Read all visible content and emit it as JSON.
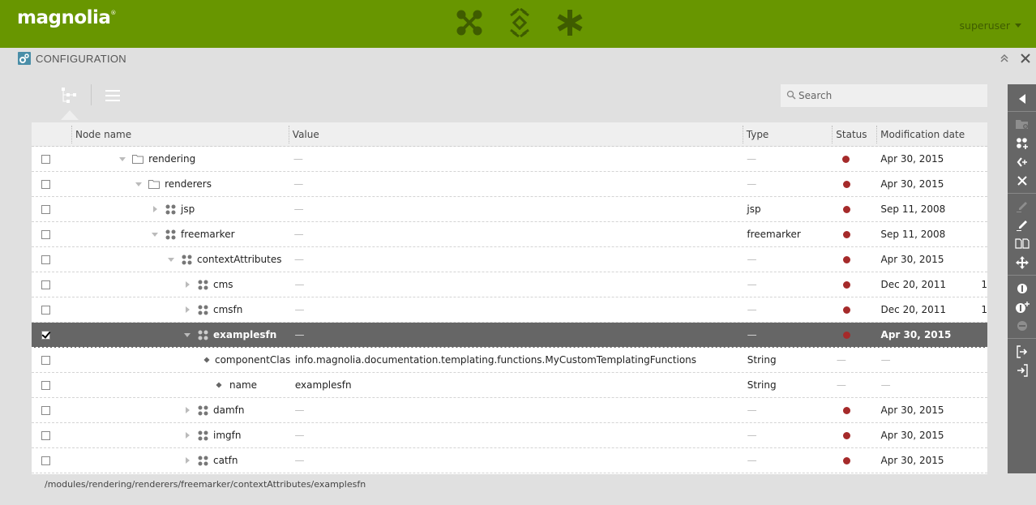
{
  "topbar": {
    "logo": "magnolia",
    "logo_mark": "®",
    "apps": [
      {
        "icon": "applauncher-icon",
        "label": "App launcher"
      },
      {
        "icon": "pulse-icon",
        "label": "Pulse"
      },
      {
        "icon": "favorites-icon",
        "label": "Favorites"
      }
    ],
    "user": "superuser"
  },
  "app": {
    "title": "CONFIGURATION",
    "icon": "configuration-gears-icon",
    "controls": [
      "collapse-icon",
      "close-icon"
    ]
  },
  "views": [
    {
      "icon": "tree-view-icon",
      "active": true
    },
    {
      "icon": "list-view-icon",
      "active": false
    }
  ],
  "search": {
    "placeholder": "Search",
    "value": ""
  },
  "grid": {
    "columns": [
      "Node name",
      "Value",
      "Type",
      "Status",
      "Modification date"
    ],
    "rows": [
      {
        "level": 0,
        "toggle": "expanded",
        "icon": "folder",
        "name": "rendering",
        "value": "—",
        "type": "—",
        "status": "published-modified",
        "date": "Apr 30, 2015",
        "checked": false,
        "selected": false
      },
      {
        "level": 1,
        "toggle": "expanded",
        "icon": "folder",
        "name": "renderers",
        "value": "—",
        "type": "—",
        "status": "published-modified",
        "date": "Apr 30, 2015",
        "checked": false,
        "selected": false
      },
      {
        "level": 2,
        "toggle": "collapsed",
        "icon": "content-node",
        "name": "jsp",
        "value": "—",
        "type": "jsp",
        "status": "published-modified",
        "date": "Sep 11, 2008",
        "checked": false,
        "selected": false
      },
      {
        "level": 2,
        "toggle": "expanded",
        "icon": "content-node",
        "name": "freemarker",
        "value": "—",
        "type": "freemarker",
        "status": "published-modified",
        "date": "Sep 11, 2008",
        "checked": false,
        "selected": false
      },
      {
        "level": 3,
        "toggle": "expanded",
        "icon": "content-node",
        "name": "contextAttributes",
        "value": "—",
        "type": "—",
        "status": "published-modified",
        "date": "Apr 30, 2015",
        "checked": false,
        "selected": false
      },
      {
        "level": 4,
        "toggle": "collapsed",
        "icon": "content-node",
        "name": "cms",
        "value": "—",
        "type": "—",
        "status": "published-modified",
        "date": "Dec 20, 2011",
        "overflow": "1",
        "checked": false,
        "selected": false
      },
      {
        "level": 4,
        "toggle": "collapsed",
        "icon": "content-node",
        "name": "cmsfn",
        "value": "—",
        "type": "—",
        "status": "published-modified",
        "date": "Dec 20, 2011",
        "overflow": "1",
        "checked": false,
        "selected": false
      },
      {
        "level": 4,
        "toggle": "expanded",
        "icon": "content-node",
        "name": "examplesfn",
        "value": "—",
        "type": "—",
        "status": "published-modified",
        "date": "Apr 30, 2015",
        "checked": true,
        "selected": true
      },
      {
        "level": 5,
        "toggle": "none",
        "icon": "property",
        "name": "componentClass",
        "value": "info.magnolia.documentation.templating.functions.MyCustomTemplatingFunctions",
        "type": "String",
        "status": "—",
        "date": "—",
        "checked": false,
        "selected": false
      },
      {
        "level": 5,
        "toggle": "none",
        "icon": "property",
        "name": "name",
        "value": "examplesfn",
        "type": "String",
        "status": "—",
        "date": "—",
        "checked": false,
        "selected": false
      },
      {
        "level": 4,
        "toggle": "collapsed",
        "icon": "content-node",
        "name": "damfn",
        "value": "—",
        "type": "—",
        "status": "published-modified",
        "date": "Apr 30, 2015",
        "checked": false,
        "selected": false
      },
      {
        "level": 4,
        "toggle": "collapsed",
        "icon": "content-node",
        "name": "imgfn",
        "value": "—",
        "type": "—",
        "status": "published-modified",
        "date": "Apr 30, 2015",
        "checked": false,
        "selected": false
      },
      {
        "level": 4,
        "toggle": "collapsed",
        "icon": "content-node",
        "name": "catfn",
        "value": "—",
        "type": "—",
        "status": "published-modified",
        "date": "Apr 30, 2015",
        "checked": false,
        "selected": false
      }
    ]
  },
  "path": "/modules/rendering/renderers/freemarker/contextAttributes/examplesfn",
  "colors": {
    "brand": "#689600",
    "status_dot": "#a52a2a",
    "selected_row": "#666666",
    "actionbar": "#666666"
  },
  "actions": [
    {
      "icon": "collapse-actionbar-icon",
      "enabled": true
    },
    {
      "sep": true
    },
    {
      "icon": "add-folder-icon",
      "enabled": false
    },
    {
      "icon": "add-content-node-icon",
      "enabled": true
    },
    {
      "icon": "add-property-icon",
      "enabled": true
    },
    {
      "icon": "delete-icon",
      "enabled": true
    },
    {
      "sep": true
    },
    {
      "icon": "edit-property-icon",
      "enabled": false
    },
    {
      "icon": "rename-icon",
      "enabled": true
    },
    {
      "icon": "duplicate-icon",
      "enabled": true
    },
    {
      "icon": "move-icon",
      "enabled": true
    },
    {
      "sep": true
    },
    {
      "icon": "activate-icon",
      "enabled": true
    },
    {
      "icon": "activate-recursive-icon",
      "enabled": true
    },
    {
      "icon": "deactivate-icon",
      "enabled": false
    },
    {
      "sep": true
    },
    {
      "icon": "export-icon",
      "enabled": true
    },
    {
      "icon": "import-icon",
      "enabled": true
    }
  ]
}
